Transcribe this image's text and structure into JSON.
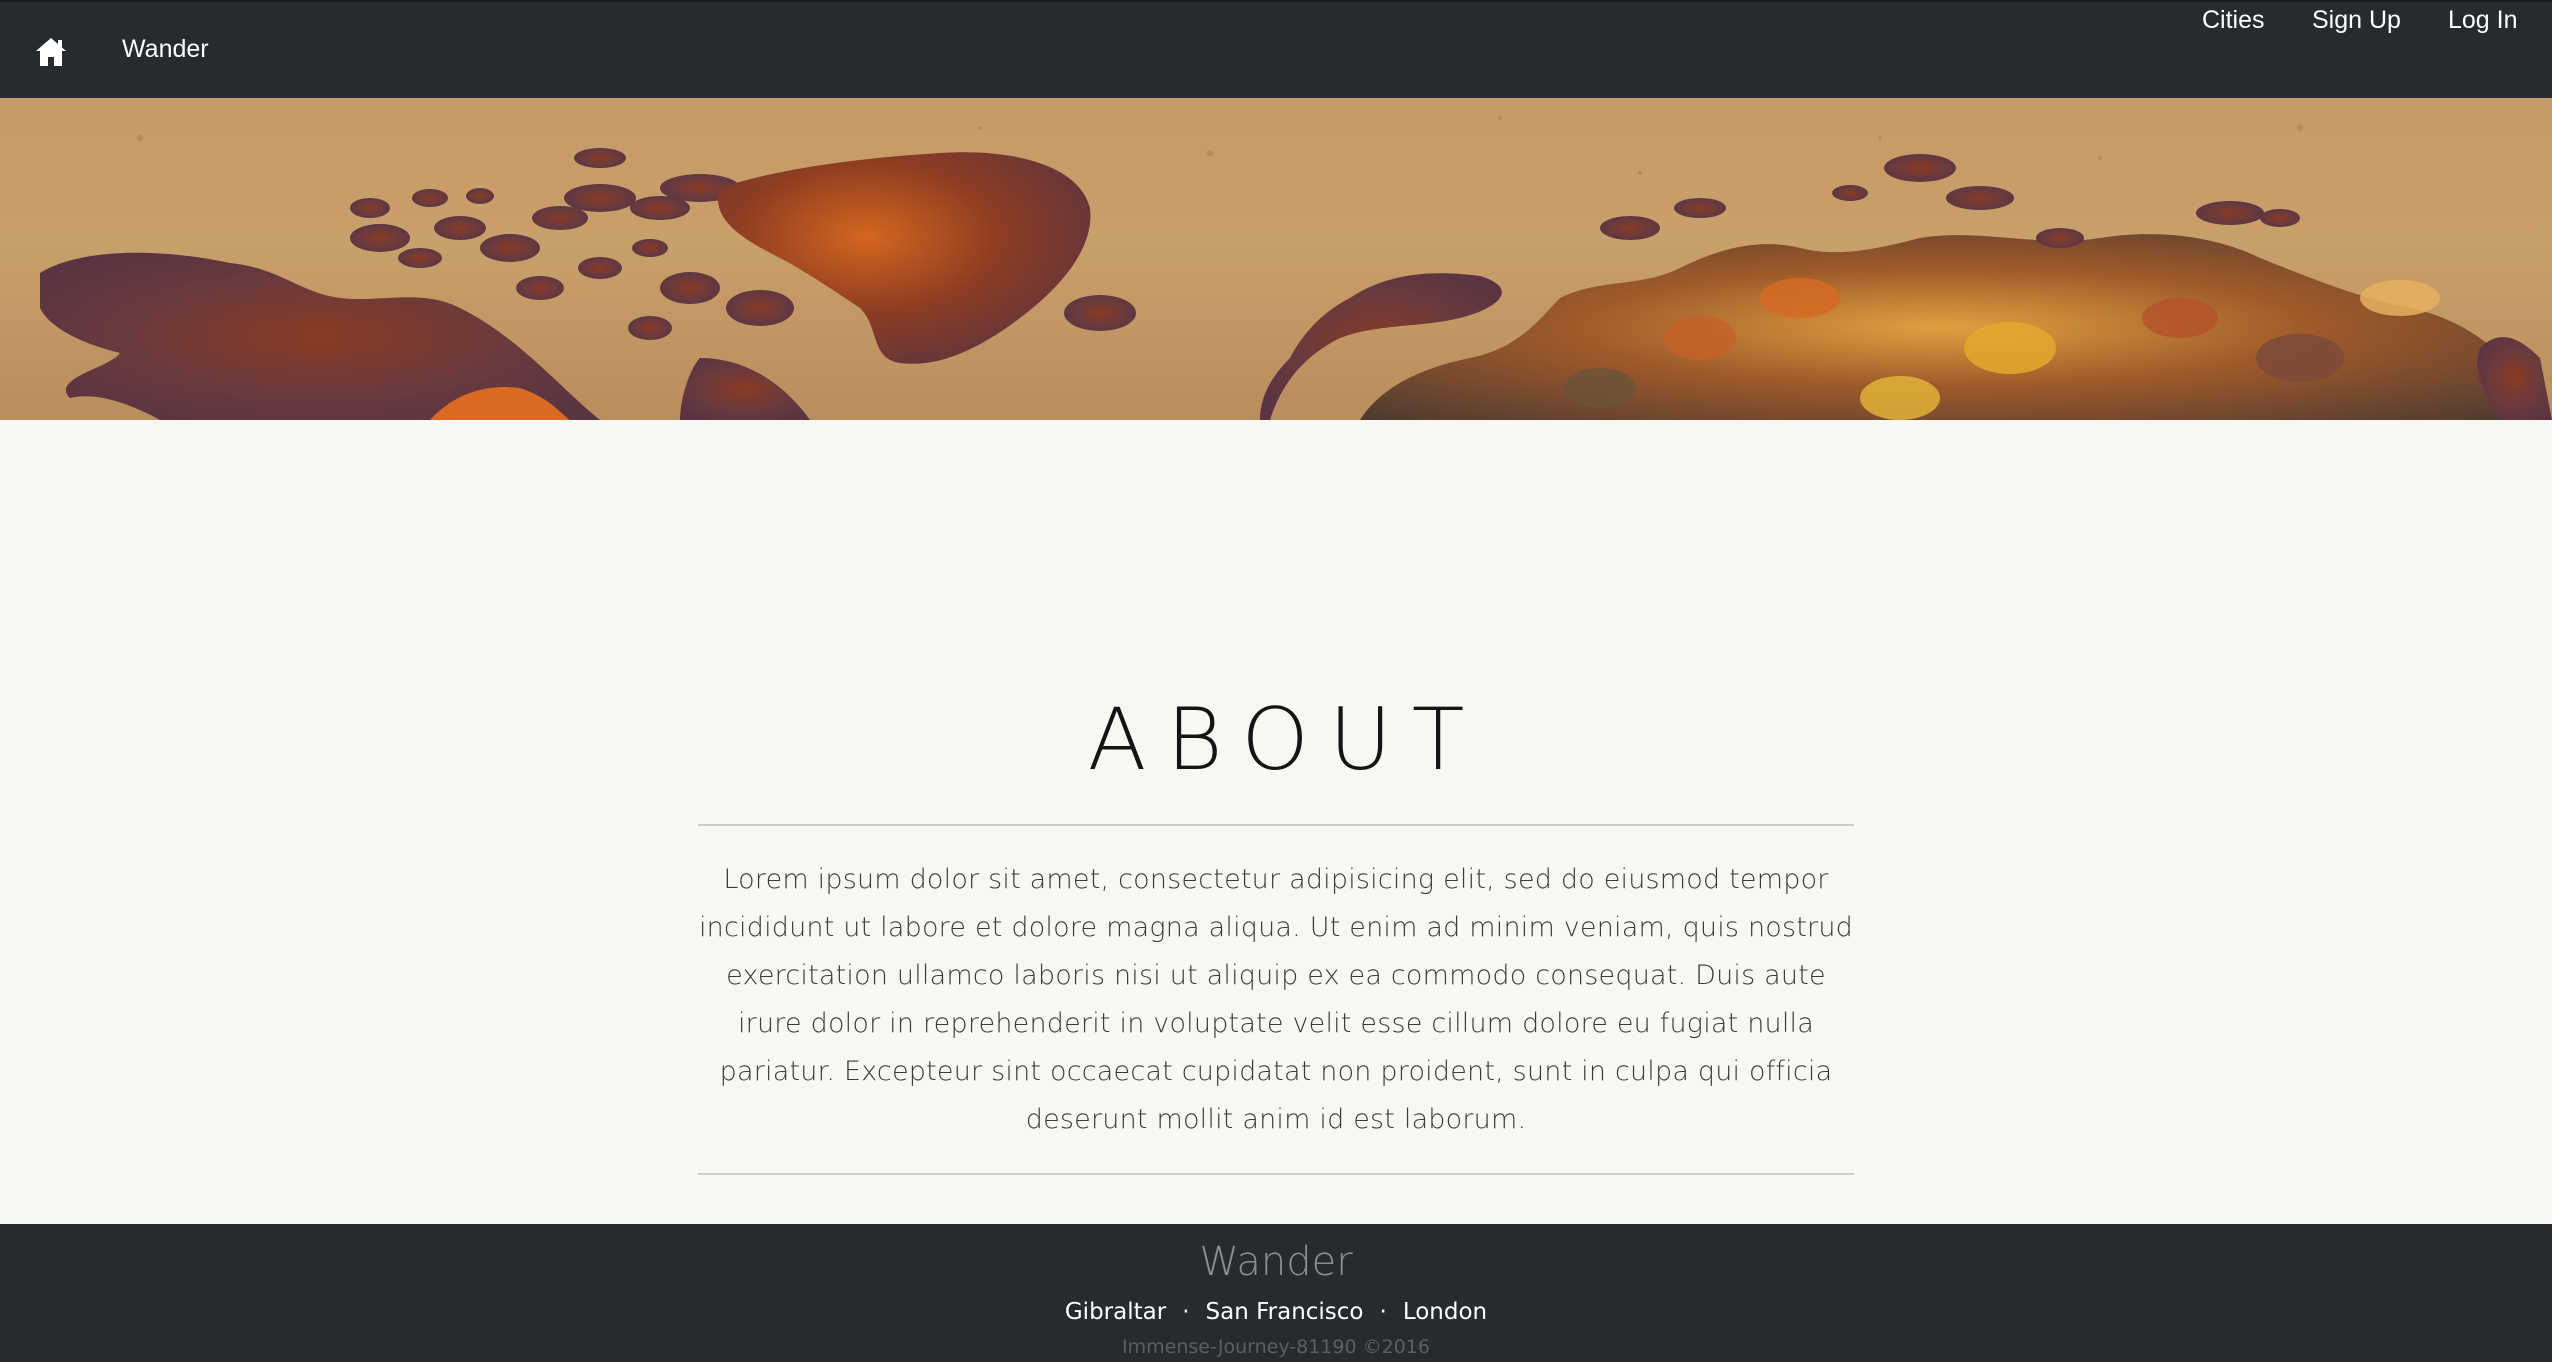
{
  "navbar": {
    "home_icon": "home-icon",
    "brand": "Wander",
    "links": [
      "Cities",
      "Sign Up",
      "Log In"
    ]
  },
  "hero": {
    "image": "rusted-world-map-banner"
  },
  "about": {
    "title": "ABOUT",
    "body": "Lorem ipsum dolor sit amet, consectetur adipisicing elit, sed do eiusmod tempor incididunt ut labore et dolore magna aliqua. Ut enim ad minim veniam, quis nostrud exercitation ullamco laboris nisi ut aliquip ex ea commodo consequat. Duis aute irure dolor in reprehenderit in voluptate velit esse cillum dolore eu fugiat nulla pariatur. Excepteur sint occaecat cupidatat non proident, sunt in culpa qui officia deserunt mollit anim id est laborum."
  },
  "footer": {
    "brand": "Wander",
    "cities": [
      "Gibraltar",
      "San Francisco",
      "London"
    ],
    "separator": "·",
    "copyright": "Immense-Journey-81190 ©2016"
  },
  "colors": {
    "navbar_bg": "#272b2e",
    "page_bg": "#f8f7f4",
    "footer_bg": "#272b2e",
    "map_base": "#c59a66"
  }
}
